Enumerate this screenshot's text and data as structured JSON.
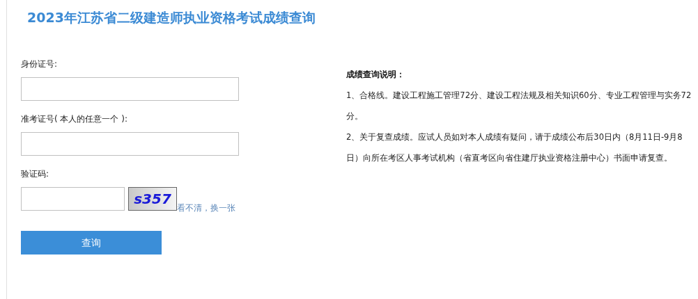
{
  "title": "2023年江苏省二级建造师执业资格考试成绩查询",
  "fields": [
    {
      "label": "身份证号:"
    },
    {
      "label": "准考证号( 本人的任意一个 ):"
    }
  ],
  "captcha": {
    "label": "验证码:",
    "code": "s357",
    "refresh_link": "看不清，换一张"
  },
  "submit_button": "查询",
  "notes": {
    "heading": "成绩查询说明：",
    "paragraphs": [
      "1、合格线。建设工程施工管理72分、建设工程法规及相关知识60分、专业工程管理与实务72分。",
      "2、关于复查成绩。应试人员如对本人成绩有疑问，请于成绩公布后30日内（8月11日-9月8日）向所在考区人事考试机构（省直考区向省住建厅执业资格注册中心）书面申请复查。"
    ]
  }
}
